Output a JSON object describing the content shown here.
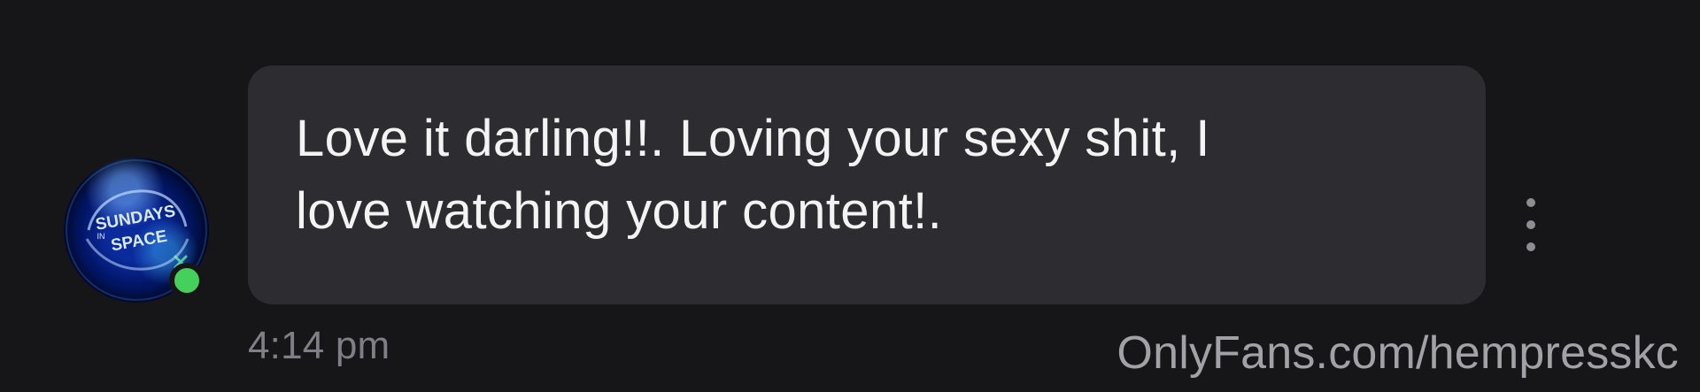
{
  "message": {
    "text": "Love it darling!!. Loving your sexy shit, I\nlove watching your content!.",
    "timestamp": "4:14 pm",
    "options_icon": "more-vertical-icon"
  },
  "sender": {
    "avatar_text": "SUNDAYS IN SPACE",
    "avatar_text_lines": [
      "SUNDAYS",
      "SPACE"
    ],
    "online_status_color": "#45cf5b"
  },
  "watermark": {
    "text": "OnlyFans.com/hempresskc"
  },
  "colors": {
    "background": "#161618",
    "bubble": "#2d2d31",
    "message_text": "#f3f3f4",
    "timestamp": "#7f7f85",
    "icon": "#8d8d92"
  }
}
